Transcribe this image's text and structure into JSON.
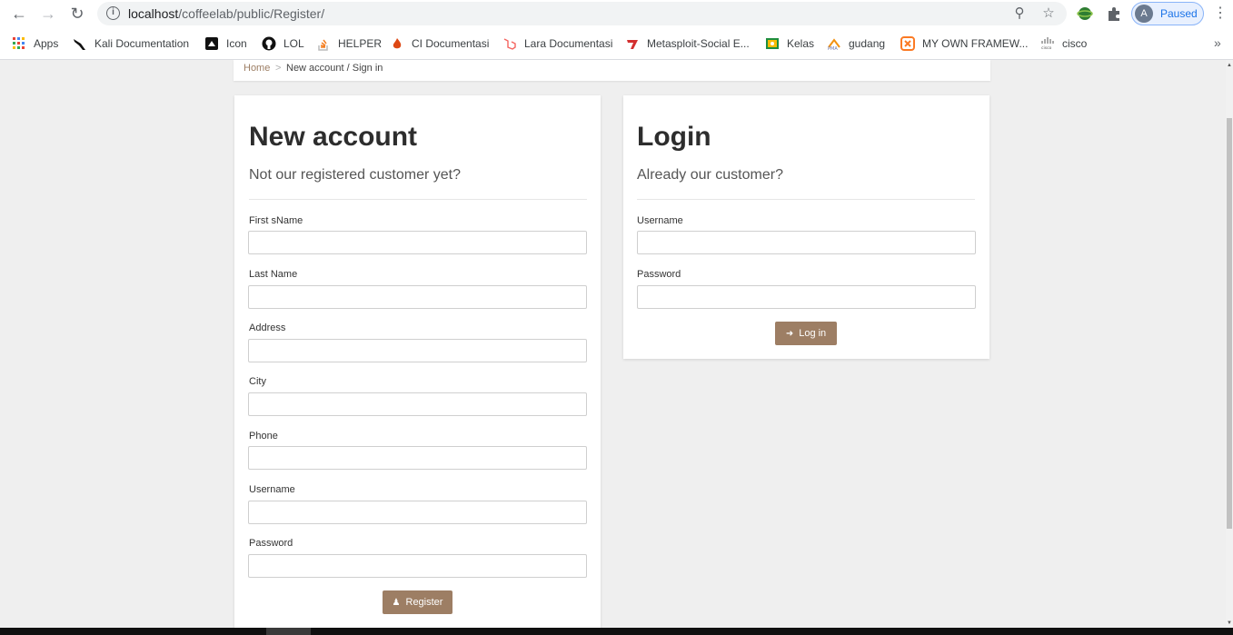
{
  "browser": {
    "url_host": "localhost",
    "url_path": "/coffeelab/public/Register/",
    "profile_initial": "A",
    "profile_status": "Paused"
  },
  "bookmarks": [
    {
      "label": "Apps",
      "icon": "apps-grid-icon"
    },
    {
      "label": "Kali Documentation",
      "icon": "kali-dragon-icon"
    },
    {
      "label": "Icon",
      "icon": "icon-site-icon"
    },
    {
      "label": "LOL",
      "icon": "github-icon"
    },
    {
      "label": "HELPER",
      "icon": "stackoverflow-icon"
    },
    {
      "label": "CI Documentasi",
      "icon": "codeigniter-flame-icon"
    },
    {
      "label": "Lara Documentasi",
      "icon": "laravel-icon"
    },
    {
      "label": "Metasploit-Social E...",
      "icon": "metasploit-icon"
    },
    {
      "label": "Kelas",
      "icon": "classroom-icon"
    },
    {
      "label": "gudang",
      "icon": "phpmyadmin-icon"
    },
    {
      "label": "MY OWN FRAMEW...",
      "icon": "xampp-icon"
    },
    {
      "label": "cisco",
      "icon": "cisco-icon"
    }
  ],
  "breadcrumb": {
    "home": "Home",
    "separator": ">",
    "current": "New account / Sign in"
  },
  "register": {
    "title": "New account",
    "lead": "Not our registered customer yet?",
    "fields": [
      {
        "label": "First sName"
      },
      {
        "label": "Last Name"
      },
      {
        "label": "Address"
      },
      {
        "label": "City"
      },
      {
        "label": "Phone"
      },
      {
        "label": "Username"
      },
      {
        "label": "Password"
      }
    ],
    "button": "Register"
  },
  "login": {
    "title": "Login",
    "lead": "Already our customer?",
    "fields": [
      {
        "label": "Username"
      },
      {
        "label": "Password"
      }
    ],
    "button": "Log in"
  },
  "colors": {
    "accent": "#9d7e64",
    "page_bg": "#efefef"
  }
}
